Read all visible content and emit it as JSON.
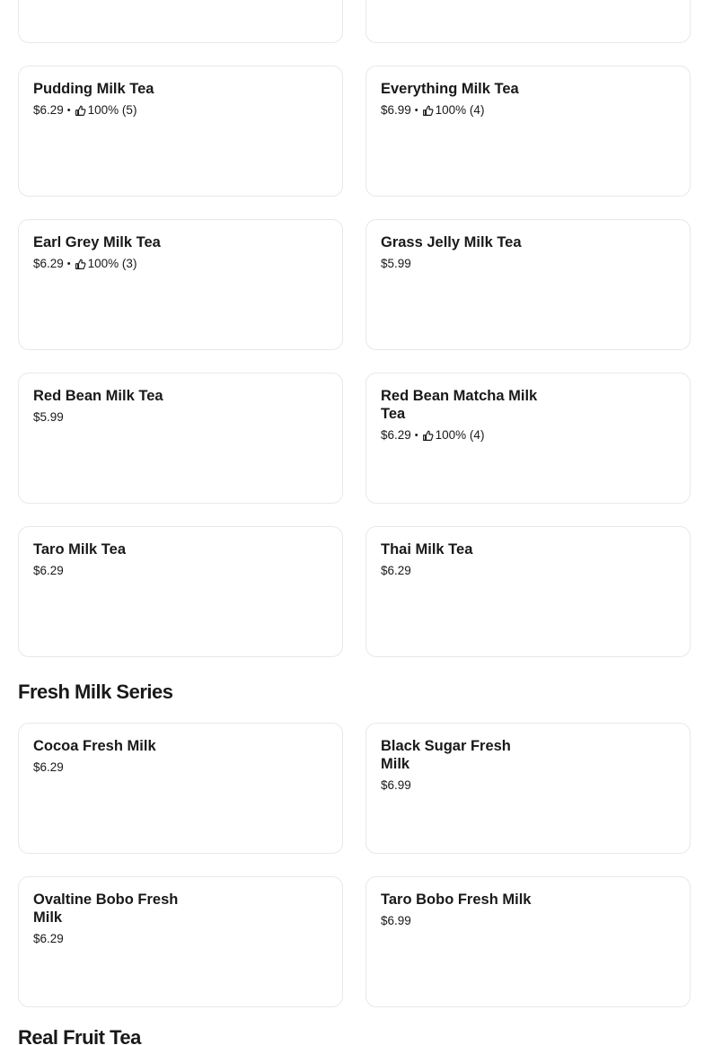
{
  "milk_tea_items": [
    {
      "name": "Pudding Milk Tea",
      "price": "$6.29",
      "rating": "100% (5)"
    },
    {
      "name": "Everything Milk Tea",
      "price": "$6.99",
      "rating": "100% (4)"
    },
    {
      "name": "Earl Grey Milk Tea",
      "price": "$6.29",
      "rating": "100% (3)"
    },
    {
      "name": "Grass Jelly Milk Tea",
      "price": "$5.99",
      "rating": null
    },
    {
      "name": "Red Bean Milk Tea",
      "price": "$5.99",
      "rating": null
    },
    {
      "name": "Red Bean Matcha Milk Tea",
      "price": "$6.29",
      "rating": "100% (4)"
    },
    {
      "name": "Taro Milk Tea",
      "price": "$6.29",
      "rating": null
    },
    {
      "name": "Thai Milk Tea",
      "price": "$6.29",
      "rating": null
    }
  ],
  "fresh_milk_section": {
    "title": "Fresh Milk Series",
    "items": [
      {
        "name": "Cocoa Fresh Milk",
        "price": "$6.29",
        "rating": null
      },
      {
        "name": "Black Sugar Fresh Milk",
        "price": "$6.99",
        "rating": null
      },
      {
        "name": "Ovaltine Bobo Fresh Milk",
        "price": "$6.29",
        "rating": null
      },
      {
        "name": "Taro Bobo Fresh Milk",
        "price": "$6.99",
        "rating": null
      }
    ]
  },
  "next_section": {
    "title": "Real Fruit Tea"
  },
  "icons": {
    "rating": "thumbs-up-icon",
    "separator": "•"
  },
  "colors": {
    "text": "#191919",
    "card_border": "#e8e8e8",
    "background": "#ffffff"
  }
}
